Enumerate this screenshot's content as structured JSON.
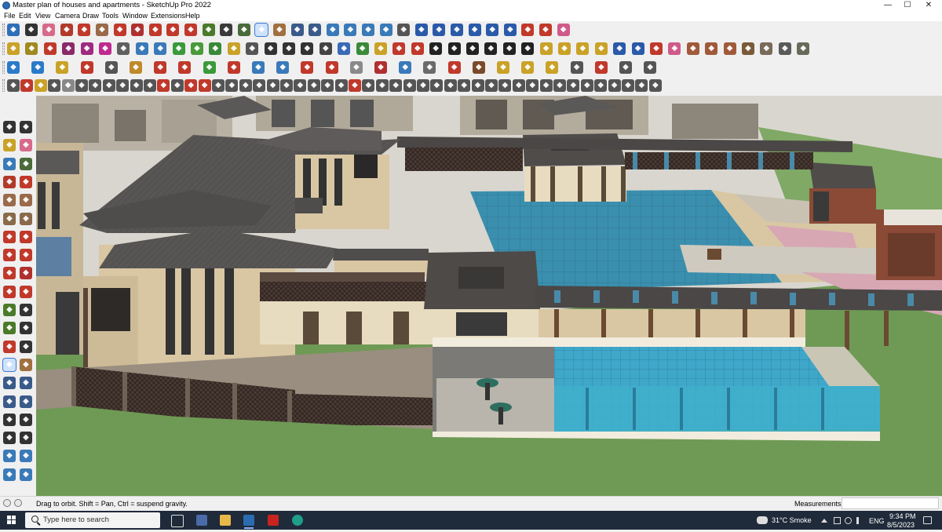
{
  "window": {
    "title": "Master plan of houses and apartments - SketchUp Pro 2022",
    "controls": [
      "—",
      "☐",
      "✕"
    ]
  },
  "menubar": [
    "File",
    "Edit",
    "View",
    "Camera",
    "Draw",
    "Tools",
    "Window",
    "Extensions",
    "Help"
  ],
  "toolbars": {
    "row1": [
      {
        "name": "zoom-extents-icon",
        "c": "#2f6fb8"
      },
      {
        "name": "select-icon",
        "c": "#333"
      },
      {
        "name": "eraser-icon",
        "c": "#d76a8a"
      },
      {
        "name": "line-icon",
        "c": "#b23a2a"
      },
      {
        "name": "arc-icon",
        "c": "#c0392b"
      },
      {
        "name": "rectangle-icon",
        "c": "#9a6a4a"
      },
      {
        "name": "push-pull-icon",
        "c": "#c0392b"
      },
      {
        "name": "follow-me-icon",
        "c": "#b03030"
      },
      {
        "name": "move-icon",
        "c": "#c0392b"
      },
      {
        "name": "rotate-icon",
        "c": "#c0392b"
      },
      {
        "name": "scale-icon",
        "c": "#c0392b"
      },
      {
        "name": "tape-measure-icon",
        "c": "#4a7a2a"
      },
      {
        "name": "text-icon",
        "c": "#3a3a3a"
      },
      {
        "name": "paint-bucket-icon",
        "c": "#4a6a3a"
      },
      {
        "name": "orbit-icon",
        "c": "#c0392b",
        "active": true
      },
      {
        "name": "pan-icon",
        "c": "#a07040"
      },
      {
        "name": "zoom-icon",
        "c": "#3a5a8a"
      },
      {
        "name": "zoom-window-icon",
        "c": "#3a5a8a"
      },
      {
        "name": "section-plane-icon",
        "c": "#3a7ab8"
      },
      {
        "name": "styles-icon",
        "c": "#3a7ab8"
      },
      {
        "name": "warehouse-icon",
        "c": "#3a7ab8"
      },
      {
        "name": "extension-icon",
        "c": "#3a7ab8"
      },
      {
        "name": "account-icon",
        "c": "#555"
      },
      {
        "name": "component-icon",
        "c": "#2a5aa8"
      },
      {
        "name": "component2-icon",
        "c": "#2a5aa8"
      },
      {
        "name": "flip-icon",
        "c": "#2a5aa8"
      },
      {
        "name": "align-icon",
        "c": "#2a5aa8"
      },
      {
        "name": "mirror-icon",
        "c": "#2a5aa8"
      },
      {
        "name": "section-icon",
        "c": "#2a5aa8"
      },
      {
        "name": "undo-arc-icon",
        "c": "#c0392b"
      },
      {
        "name": "redo-arc-icon",
        "c": "#c0392b"
      },
      {
        "name": "clear-icon",
        "c": "#d05a8a"
      }
    ],
    "row2": [
      {
        "name": "iso-view-icon",
        "c": "#c9a227"
      },
      {
        "name": "top-view-icon",
        "c": "#a08a20"
      },
      {
        "name": "front-view-icon",
        "c": "#c0392b"
      },
      {
        "name": "right-view-icon",
        "c": "#8a2a6a"
      },
      {
        "name": "back-view-icon",
        "c": "#a02a80"
      },
      {
        "name": "left-view-icon",
        "c": "#c02a90"
      },
      {
        "name": "perspective-icon",
        "c": "#606060"
      },
      {
        "name": "xray-icon",
        "c": "#3a7ab8"
      },
      {
        "name": "back-edges-icon",
        "c": "#3a7ab8"
      },
      {
        "name": "wireframe-icon",
        "c": "#3a9a3a"
      },
      {
        "name": "hidden-line-icon",
        "c": "#4a9a3a"
      },
      {
        "name": "shaded-icon",
        "c": "#3a8a3a"
      },
      {
        "name": "textured-icon",
        "c": "#c9a227"
      },
      {
        "name": "monochrome-icon",
        "c": "#555"
      },
      {
        "name": "shadow-icon",
        "c": "#333"
      },
      {
        "name": "fog-icon",
        "c": "#333"
      },
      {
        "name": "edge-icon",
        "c": "#333"
      },
      {
        "name": "sandbox-icon",
        "c": "#444"
      },
      {
        "name": "contour-icon",
        "c": "#3a6ab8"
      },
      {
        "name": "drape-icon",
        "c": "#3a8a3a"
      },
      {
        "name": "stamp-icon",
        "c": "#c9a227"
      },
      {
        "name": "pencil-tool-icon",
        "c": "#c0392b"
      },
      {
        "name": "paint-tool-icon",
        "c": "#c0392b"
      },
      {
        "name": "ring-a-icon",
        "c": "#222"
      },
      {
        "name": "ring-b-icon",
        "c": "#222"
      },
      {
        "name": "ring-c-icon",
        "c": "#222"
      },
      {
        "name": "ring-d-icon",
        "c": "#222"
      },
      {
        "name": "ring-e-icon",
        "c": "#222"
      },
      {
        "name": "ring-f-icon",
        "c": "#222"
      },
      {
        "name": "grid-a-icon",
        "c": "#c9a227"
      },
      {
        "name": "grid-b-icon",
        "c": "#c9a227"
      },
      {
        "name": "grid-c-icon",
        "c": "#c9a227"
      },
      {
        "name": "grid-d-icon",
        "c": "#c9a227"
      },
      {
        "name": "loop-a-icon",
        "c": "#2a5aa8"
      },
      {
        "name": "loop-b-icon",
        "c": "#2a5aa8"
      },
      {
        "name": "knife-icon",
        "c": "#c0392b"
      },
      {
        "name": "tag-icon",
        "c": "#d05a8a"
      },
      {
        "name": "material-a-icon",
        "c": "#a05a3a"
      },
      {
        "name": "material-b-icon",
        "c": "#a05a3a"
      },
      {
        "name": "material-c-icon",
        "c": "#a05a3a"
      },
      {
        "name": "material-d-icon",
        "c": "#7a5a3a"
      },
      {
        "name": "material-e-icon",
        "c": "#7a6a5a"
      },
      {
        "name": "material-f-icon",
        "c": "#5a5a5a"
      },
      {
        "name": "material-g-icon",
        "c": "#6a6a5a"
      }
    ],
    "row3": [
      {
        "name": "plugin-a-icon",
        "c": "#2a7ac8"
      },
      {
        "name": "plugin-b-icon",
        "c": "#2a7ac8"
      },
      {
        "name": "plugin-c-icon",
        "c": "#c9a227"
      },
      {
        "name": "plugin-d-icon",
        "c": "#c0392b"
      },
      {
        "name": "plugin-e-icon",
        "c": "#555"
      },
      {
        "name": "plugin-f-icon",
        "c": "#c08a2a"
      },
      {
        "name": "plugin-g-icon",
        "c": "#c0392b"
      },
      {
        "name": "plugin-h-icon",
        "c": "#c0392b"
      },
      {
        "name": "plugin-i-icon",
        "c": "#3a9a3a"
      },
      {
        "name": "plugin-j-icon",
        "c": "#c0392b"
      },
      {
        "name": "plugin-k-icon",
        "c": "#3a7ab8"
      },
      {
        "name": "plugin-l-icon",
        "c": "#3a7ab8"
      },
      {
        "name": "plugin-m-icon",
        "c": "#c0392b"
      },
      {
        "name": "plugin-n-icon",
        "c": "#c0392b"
      },
      {
        "name": "plugin-o-icon",
        "c": "#8a8a8a"
      },
      {
        "name": "plugin-p-icon",
        "c": "#b03030"
      },
      {
        "name": "plugin-q-icon",
        "c": "#3a7ab8"
      },
      {
        "name": "plugin-r-icon",
        "c": "#6a6a6a"
      },
      {
        "name": "plugin-s-icon",
        "c": "#c0392b"
      },
      {
        "name": "plugin-t-icon",
        "c": "#7a4a2a"
      },
      {
        "name": "plugin-u-icon",
        "c": "#c9a227"
      },
      {
        "name": "plugin-v-icon",
        "c": "#c9a227"
      },
      {
        "name": "plugin-w-icon",
        "c": "#c9a227"
      },
      {
        "name": "plugin-x-icon",
        "c": "#555"
      },
      {
        "name": "plugin-y-icon",
        "c": "#c0392b"
      },
      {
        "name": "plugin-z-icon",
        "c": "#555"
      },
      {
        "name": "plugin-aa-icon",
        "c": "#555"
      }
    ],
    "row4": [
      {
        "name": "edge-tool-a-icon",
        "c": "#555"
      },
      {
        "name": "edge-tool-b-icon",
        "c": "#c0392b"
      },
      {
        "name": "edge-tool-c-icon",
        "c": "#c9a227"
      },
      {
        "name": "edge-tool-d-icon",
        "c": "#555"
      },
      {
        "name": "edge-tool-e-icon",
        "c": "#888"
      },
      {
        "name": "edge-tool-f-icon",
        "c": "#555"
      },
      {
        "name": "edge-tool-g-icon",
        "c": "#555"
      },
      {
        "name": "edge-tool-h-icon",
        "c": "#555"
      },
      {
        "name": "edge-tool-i-icon",
        "c": "#555"
      },
      {
        "name": "edge-tool-j-icon",
        "c": "#555"
      },
      {
        "name": "edge-tool-k-icon",
        "c": "#555"
      },
      {
        "name": "edge-tool-l-icon",
        "c": "#c0392b"
      },
      {
        "name": "edge-tool-m-icon",
        "c": "#555"
      },
      {
        "name": "edge-tool-n-icon",
        "c": "#c0392b"
      },
      {
        "name": "edge-tool-o-icon",
        "c": "#c0392b"
      },
      {
        "name": "edge-tool-p-icon",
        "c": "#555"
      },
      {
        "name": "edge-tool-q-icon",
        "c": "#555"
      },
      {
        "name": "edge-tool-r-icon",
        "c": "#555"
      },
      {
        "name": "edge-tool-s-icon",
        "c": "#555"
      },
      {
        "name": "edge-tool-t-icon",
        "c": "#555"
      },
      {
        "name": "edge-tool-u-icon",
        "c": "#555"
      },
      {
        "name": "edge-tool-v-icon",
        "c": "#555"
      },
      {
        "name": "edge-tool-w-icon",
        "c": "#555"
      },
      {
        "name": "edge-tool-x-icon",
        "c": "#555"
      },
      {
        "name": "edge-tool-y-icon",
        "c": "#555"
      },
      {
        "name": "edge-tool-z-icon",
        "c": "#c0392b"
      },
      {
        "name": "edge-tool-aa-icon",
        "c": "#555"
      },
      {
        "name": "edge-tool-ab-icon",
        "c": "#555"
      },
      {
        "name": "edge-tool-ac-icon",
        "c": "#555"
      },
      {
        "name": "edge-tool-ad-icon",
        "c": "#555"
      },
      {
        "name": "edge-tool-ae-icon",
        "c": "#555"
      },
      {
        "name": "edge-tool-af-icon",
        "c": "#555"
      },
      {
        "name": "edge-tool-ag-icon",
        "c": "#555"
      },
      {
        "name": "edge-tool-ah-icon",
        "c": "#555"
      },
      {
        "name": "edge-tool-ai-icon",
        "c": "#555"
      },
      {
        "name": "edge-tool-aj-icon",
        "c": "#555"
      },
      {
        "name": "edge-tool-ak-icon",
        "c": "#555"
      },
      {
        "name": "edge-tool-al-icon",
        "c": "#555"
      },
      {
        "name": "edge-tool-am-icon",
        "c": "#555"
      },
      {
        "name": "edge-tool-an-icon",
        "c": "#555"
      },
      {
        "name": "edge-tool-ao-icon",
        "c": "#555"
      },
      {
        "name": "edge-tool-ap-icon",
        "c": "#555"
      },
      {
        "name": "edge-tool-aq-icon",
        "c": "#555"
      },
      {
        "name": "edge-tool-ar-icon",
        "c": "#555"
      },
      {
        "name": "edge-tool-as-icon",
        "c": "#555"
      },
      {
        "name": "edge-tool-at-icon",
        "c": "#555"
      },
      {
        "name": "edge-tool-au-icon",
        "c": "#555"
      },
      {
        "name": "edge-tool-av-icon",
        "c": "#555"
      }
    ],
    "left": [
      {
        "name": "select-tool-icon",
        "c": "#333"
      },
      {
        "name": "component-tool-icon",
        "c": "#333"
      },
      {
        "name": "paint-tool-left-icon",
        "c": "#c9a227"
      },
      {
        "name": "eraser-tool-left-icon",
        "c": "#d76a8a"
      },
      {
        "name": "solid-tool-icon",
        "c": "#3a7ab8"
      },
      {
        "name": "tag-tool-left-icon",
        "c": "#4a6a3a"
      },
      {
        "name": "line-tool-left-icon",
        "c": "#b23a2a"
      },
      {
        "name": "freehand-tool-icon",
        "c": "#c0392b"
      },
      {
        "name": "rectangle-tool-left-icon",
        "c": "#9a6a4a"
      },
      {
        "name": "rotated-rect-icon",
        "c": "#9a6a4a"
      },
      {
        "name": "circle-tool-icon",
        "c": "#8a6a4a"
      },
      {
        "name": "polygon-tool-icon",
        "c": "#8a6a4a"
      },
      {
        "name": "arc-tool-left-icon",
        "c": "#c0392b"
      },
      {
        "name": "pie-tool-icon",
        "c": "#c0392b"
      },
      {
        "name": "offset-tool-icon",
        "c": "#c0392b"
      },
      {
        "name": "follow-tool-left-icon",
        "c": "#c0392b"
      },
      {
        "name": "move-tool-left-icon",
        "c": "#c0392b"
      },
      {
        "name": "push-tool-left-icon",
        "c": "#b03030"
      },
      {
        "name": "rotate-tool-left-icon",
        "c": "#c0392b"
      },
      {
        "name": "scale-tool-left-icon",
        "c": "#c0392b"
      },
      {
        "name": "tape-tool-left-icon",
        "c": "#4a7a2a"
      },
      {
        "name": "text-tool-left-icon",
        "c": "#333"
      },
      {
        "name": "protractor-icon",
        "c": "#4a7a2a"
      },
      {
        "name": "dimension-icon",
        "c": "#333"
      },
      {
        "name": "axes-tool-icon",
        "c": "#c0392b"
      },
      {
        "name": "3dtext-icon",
        "c": "#333"
      },
      {
        "name": "orbit-tool-left-icon",
        "c": "#c0392b",
        "active": true
      },
      {
        "name": "pan-tool-left-icon",
        "c": "#a07040"
      },
      {
        "name": "zoom-tool-left-icon",
        "c": "#3a5a8a"
      },
      {
        "name": "zoom-window-left-icon",
        "c": "#3a5a8a"
      },
      {
        "name": "zoom-extents-left-icon",
        "c": "#3a5a8a"
      },
      {
        "name": "previous-view-icon",
        "c": "#3a5a8a"
      },
      {
        "name": "position-camera-icon",
        "c": "#333"
      },
      {
        "name": "look-around-icon",
        "c": "#333"
      },
      {
        "name": "walk-tool-icon",
        "c": "#333"
      },
      {
        "name": "section-tool-left-icon",
        "c": "#333"
      },
      {
        "name": "sandbox-a-icon",
        "c": "#3a7ab8"
      },
      {
        "name": "sandbox-b-icon",
        "c": "#3a7ab8"
      },
      {
        "name": "sandbox-c-icon",
        "c": "#3a7ab8"
      },
      {
        "name": "sandbox-d-icon",
        "c": "#3a7ab8"
      }
    ]
  },
  "statusbar": {
    "hint": "Drag to orbit. Shift = Pan, Ctrl = suspend gravity.",
    "measurements_label": "Measurements",
    "measurements_value": ""
  },
  "taskbar": {
    "search_placeholder": "Type here to search",
    "apps": [
      "task-view-icon",
      "calculator-icon",
      "file-explorer-icon",
      "sketchup-icon",
      "acrobat-icon",
      "edge-icon"
    ],
    "weather": "31°C  Smoke",
    "language": "ENG",
    "time": "9:34 PM",
    "date": "8/5/2023"
  },
  "colors": {
    "sky": "#d9d6cf",
    "ground": "#6f9a55",
    "pool": "#3a8fb0",
    "roof": "#5b5858",
    "wall": "#d9c7a3",
    "accent": "#3d7bd6"
  }
}
